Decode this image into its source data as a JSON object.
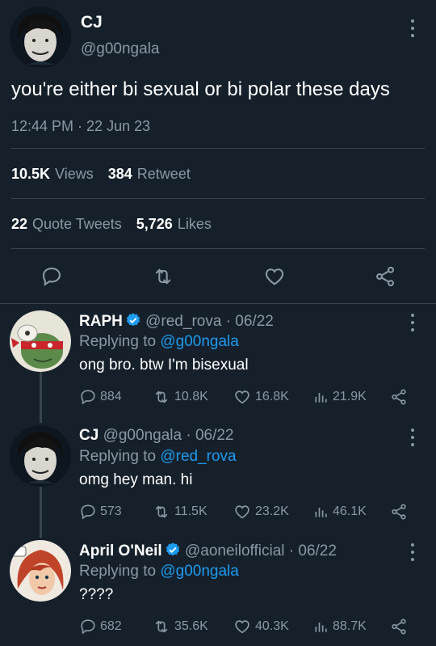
{
  "tweet": {
    "author_name": "CJ",
    "author_handle": "@g00ngala",
    "text": "you're either bi sexual or bi polar these days",
    "timestamp": "12:44 PM · 22 Jun 23",
    "views_count": "10.5K",
    "views_label": "Views",
    "retweets_count": "384",
    "retweets_label": "Retweet",
    "quotes_count": "22",
    "quotes_label": "Quote Tweets",
    "likes_count": "5,726",
    "likes_label": "Likes"
  },
  "icons": {
    "reply": "reply-icon",
    "retweet": "retweet-icon",
    "like": "heart-icon",
    "share": "share-icon",
    "views": "views-icon",
    "more": "more-icon",
    "verified": "verified-badge-icon"
  },
  "colors": {
    "background": "#15202b",
    "divider": "#38444d",
    "muted": "#8b98a5",
    "accent": "#1d9bf0"
  },
  "replies": [
    {
      "name": "RAPH",
      "verified": true,
      "handle": "@red_rova",
      "date": "· 06/22",
      "replying_label": "Replying to",
      "replying_to": "@g00ngala",
      "text": "ong bro. btw I'm bisexual",
      "replies": "884",
      "retweets": "10.8K",
      "likes": "16.8K",
      "views": "21.9K"
    },
    {
      "name": "CJ",
      "verified": false,
      "handle": "@g00ngala",
      "date": "· 06/22",
      "replying_label": "Replying to",
      "replying_to": "@red_rova",
      "text": "omg hey man. hi",
      "replies": "573",
      "retweets": "11.5K",
      "likes": "23.2K",
      "views": "46.1K"
    },
    {
      "name": "April O'Neil",
      "verified": true,
      "handle": "@aoneilofficial",
      "date": "· 06/22",
      "replying_label": "Replying to",
      "replying_to": "@g00ngala",
      "text": "????",
      "replies": "682",
      "retweets": "35.6K",
      "likes": "40.3K",
      "views": "88.7K"
    }
  ]
}
